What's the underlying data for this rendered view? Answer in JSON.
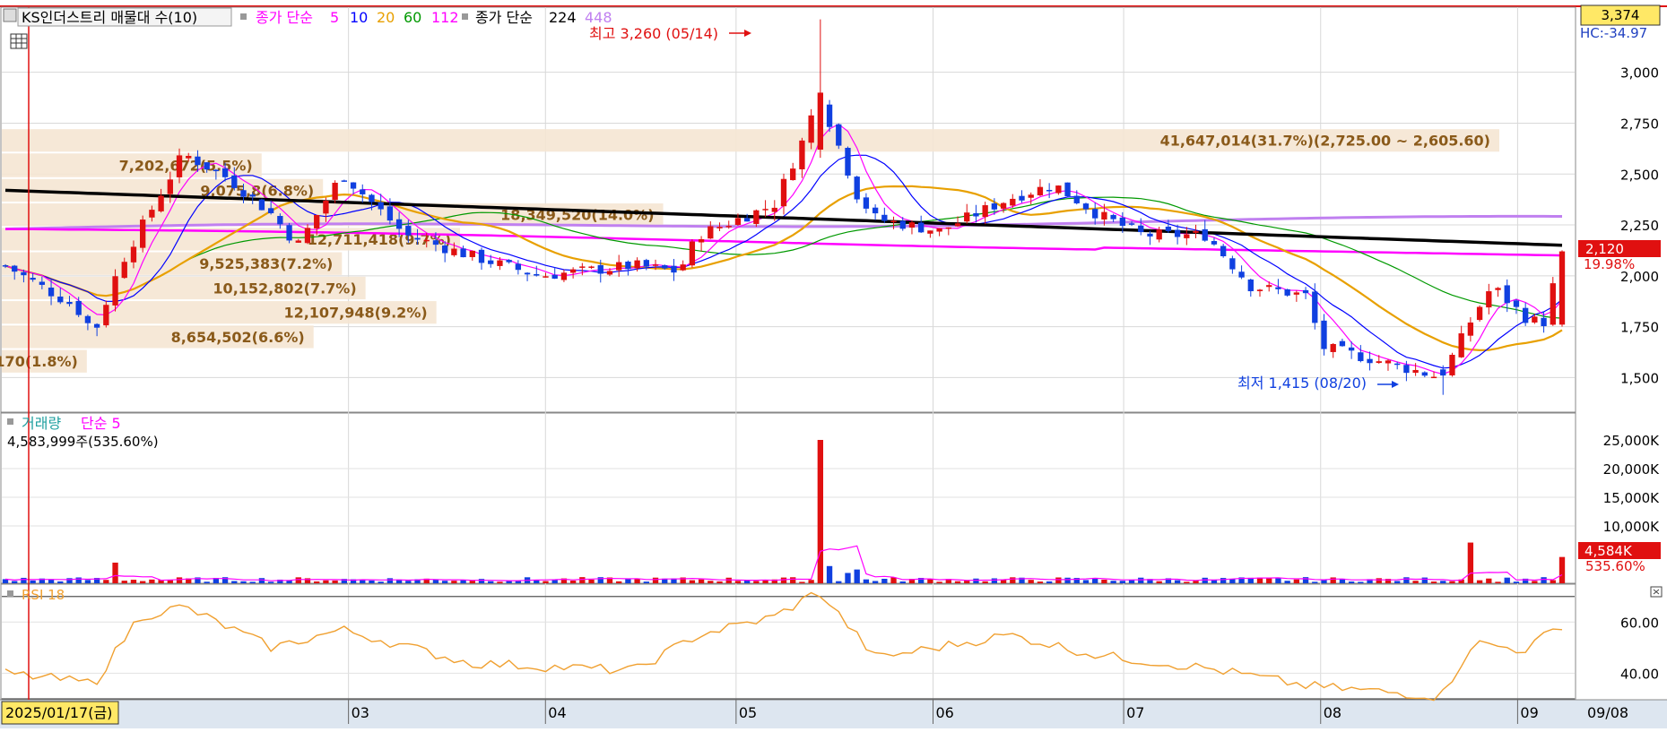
{
  "price_panel": {
    "legend": {
      "vp_label": "KS인더스트리 매물대 수(10)",
      "ma_label": "종가 단순",
      "ma_periods": [
        "5",
        "10",
        "20",
        "60",
        "112"
      ],
      "ma_colors": [
        "#ff00ff",
        "#0000ff",
        "#e8a000",
        "#009900",
        "#ff00ff"
      ],
      "ma_long_label": "종가 단순",
      "ma_long_periods": [
        "224",
        "448"
      ],
      "ma_long_colors": [
        "#000000",
        "#c080f0"
      ]
    },
    "current_badge": "3,374",
    "hc_text": "HC:-34.97",
    "last_price_label": "2,120",
    "last_change_label": "19.98%",
    "high_annotation": "최고 3,260 (05/14)",
    "low_annotation": "최저 1,415 (08/20)",
    "y_ticks": [
      "3,000",
      "2,750",
      "2,500",
      "2,250",
      "2,000",
      "1,750",
      "1,500"
    ],
    "volume_profile": [
      {
        "label": "41,647,014(31.7%)(2,725.00 ~ 2,605.60)",
        "pct": 31.7
      },
      {
        "label": "7,202,672(5.5%)",
        "pct": 5.5
      },
      {
        "label": "9,075,8(6.8%)",
        "pct": 6.8
      },
      {
        "label": "18,349,520(14.0%)",
        "pct": 14.0
      },
      {
        "label": "12,711,418(9.7%)",
        "pct": 9.7
      },
      {
        "label": "9,525,383(7.2%)",
        "pct": 7.2
      },
      {
        "label": "10,152,802(7.7%)",
        "pct": 7.7
      },
      {
        "label": "12,107,948(9.2%)",
        "pct": 9.2
      },
      {
        "label": "8,654,502(6.6%)",
        "pct": 6.6
      },
      {
        "label": "2,410,170(1.8%)",
        "pct": 1.8
      }
    ]
  },
  "volume_panel": {
    "title": "거래량",
    "ma_label": "단순 5",
    "current_text": "4,583,999주(535.60%)",
    "y_ticks": [
      "25,000K",
      "20,000K",
      "15,000K",
      "10,000K"
    ],
    "last_label": "4,584K",
    "last_pct": "535.60%"
  },
  "rsi_panel": {
    "title": "RSI 18",
    "y_ticks": [
      "60.00",
      "40.00"
    ]
  },
  "x_axis": {
    "cursor_date": "2025/01/17(금)",
    "months": [
      "03",
      "04",
      "05",
      "06",
      "07",
      "08",
      "09"
    ],
    "end_label": "09/08"
  },
  "colors": {
    "up": "#e01010",
    "down": "#1040e0",
    "vp_fill": "#f5e6d3",
    "ma5": "#ff00ff",
    "ma10": "#0000ff",
    "ma20": "#e8a000",
    "ma60": "#009900",
    "ma112": "#ff00ff",
    "ma224": "#000000",
    "ma448": "#c080f0",
    "rsi": "#f0a030"
  },
  "chart_data": [
    {
      "type": "candlestick",
      "title": "KS인더스트리",
      "x_range": [
        "2025-01-06",
        "2025-09-08"
      ],
      "ylim": [
        1330,
        3320
      ],
      "high": {
        "value": 3260,
        "date": "05/14"
      },
      "low": {
        "value": 1415,
        "date": "08/20"
      },
      "last_close": 2120,
      "ohlc_anchors": [
        {
          "date": "01/06",
          "close": 2050
        },
        {
          "date": "01/17",
          "close": 1850
        },
        {
          "date": "01/20",
          "close": 1720
        },
        {
          "date": "01/24",
          "close": 2050
        },
        {
          "date": "02/03",
          "close": 2600
        },
        {
          "date": "02/10",
          "close": 2480
        },
        {
          "date": "02/17",
          "close": 2300
        },
        {
          "date": "02/21",
          "close": 2150
        },
        {
          "date": "02/28",
          "close": 2500
        },
        {
          "date": "03/10",
          "close": 2200
        },
        {
          "date": "03/20",
          "close": 2100
        },
        {
          "date": "03/31",
          "close": 2000
        },
        {
          "date": "04/15",
          "close": 2050
        },
        {
          "date": "04/22",
          "close": 2020
        },
        {
          "date": "04/25",
          "close": 2200
        },
        {
          "date": "05/07",
          "close": 2350
        },
        {
          "date": "05/12",
          "close": 2700
        },
        {
          "date": "05/14",
          "close": 2900
        },
        {
          "date": "05/20",
          "close": 2400
        },
        {
          "date": "05/23",
          "close": 2280
        },
        {
          "date": "06/02",
          "close": 2220
        },
        {
          "date": "06/13",
          "close": 2380
        },
        {
          "date": "06/20",
          "close": 2450
        },
        {
          "date": "06/27",
          "close": 2300
        },
        {
          "date": "07/04",
          "close": 2200
        },
        {
          "date": "07/14",
          "close": 2200
        },
        {
          "date": "07/21",
          "close": 1950
        },
        {
          "date": "07/30",
          "close": 1900
        },
        {
          "date": "08/01",
          "close": 1650
        },
        {
          "date": "08/08",
          "close": 1600
        },
        {
          "date": "08/20",
          "close": 1500
        },
        {
          "date": "08/25",
          "close": 1800
        },
        {
          "date": "08/28",
          "close": 1950
        },
        {
          "date": "09/02",
          "close": 1800
        },
        {
          "date": "09/05",
          "close": 1760
        },
        {
          "date": "09/08",
          "close": 2120
        }
      ],
      "moving_averages": {
        "ma224_start": 2420,
        "ma224_end": 2150,
        "ma448_start": 2230,
        "ma448_end": 2280,
        "ma112_start": 2230,
        "ma112_end": 2100
      }
    },
    {
      "type": "bar",
      "title": "거래량",
      "ylabel": "K",
      "ylim": [
        0,
        25000
      ],
      "spikes": [
        {
          "date": "01/24",
          "value": 3600
        },
        {
          "date": "05/14",
          "value": 25000
        },
        {
          "date": "05/15",
          "value": 13500
        },
        {
          "date": "08/25",
          "value": 7100
        },
        {
          "date": "09/08",
          "value": 4584
        }
      ],
      "baseline_value": 600
    },
    {
      "type": "line",
      "title": "RSI 18",
      "ylim": [
        30,
        72
      ],
      "anchors": [
        {
          "date": "01/06",
          "value": 40
        },
        {
          "date": "01/20",
          "value": 36
        },
        {
          "date": "01/27",
          "value": 62
        },
        {
          "date": "02/03",
          "value": 66
        },
        {
          "date": "02/17",
          "value": 50
        },
        {
          "date": "02/28",
          "value": 57
        },
        {
          "date": "03/20",
          "value": 44
        },
        {
          "date": "04/15",
          "value": 41
        },
        {
          "date": "04/25",
          "value": 55
        },
        {
          "date": "05/07",
          "value": 62
        },
        {
          "date": "05/14",
          "value": 72
        },
        {
          "date": "05/23",
          "value": 46
        },
        {
          "date": "06/13",
          "value": 55
        },
        {
          "date": "06/27",
          "value": 47
        },
        {
          "date": "07/14",
          "value": 42
        },
        {
          "date": "07/30",
          "value": 35
        },
        {
          "date": "08/20",
          "value": 31
        },
        {
          "date": "08/25",
          "value": 52
        },
        {
          "date": "09/02",
          "value": 49
        },
        {
          "date": "09/08",
          "value": 59
        }
      ]
    }
  ]
}
